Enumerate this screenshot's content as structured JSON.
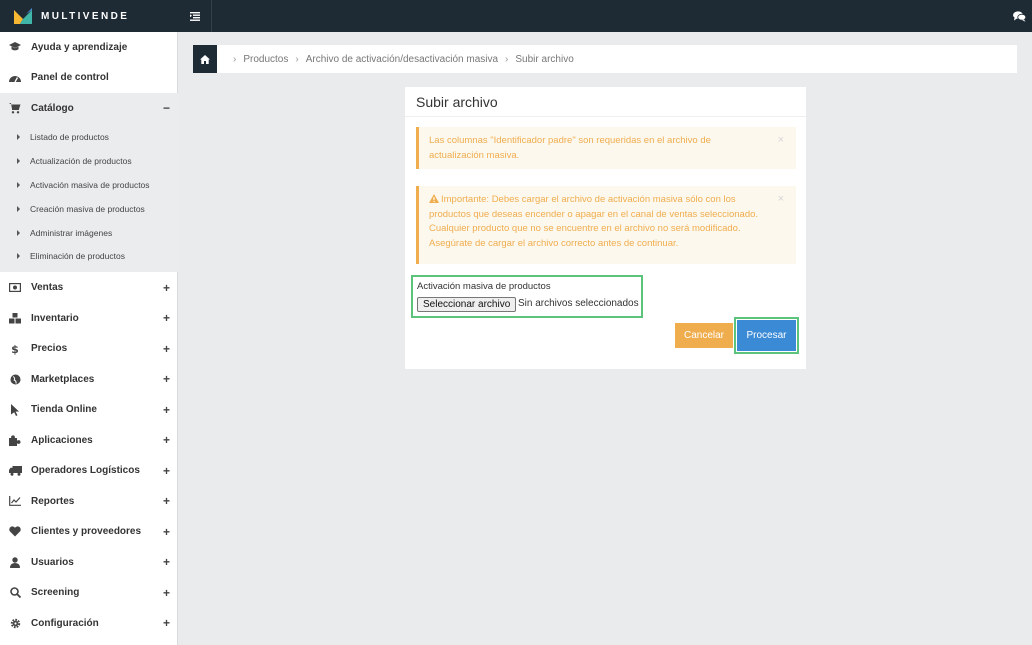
{
  "brand": {
    "name": "MULTIVENDE"
  },
  "sidebar": {
    "items": [
      {
        "label": "Ayuda y aprendizaje",
        "icon": "graduation-cap-icon"
      },
      {
        "label": "Panel de control",
        "icon": "dashboard-icon"
      },
      {
        "label": "Catálogo",
        "icon": "cart-icon",
        "toggle": "−",
        "expanded": true,
        "subitems": [
          "Listado de productos",
          "Actualización de productos",
          "Activación masiva de productos",
          "Creación masiva de productos",
          "Administrar imágenes",
          "Eliminación de productos"
        ]
      },
      {
        "label": "Ventas",
        "icon": "money-icon",
        "toggle": "+"
      },
      {
        "label": "Inventario",
        "icon": "cubes-icon",
        "toggle": "+"
      },
      {
        "label": "Precios",
        "icon": "dollar-icon",
        "toggle": "+"
      },
      {
        "label": "Marketplaces",
        "icon": "globe-icon",
        "toggle": "+"
      },
      {
        "label": "Tienda Online",
        "icon": "pointer-icon",
        "toggle": "+"
      },
      {
        "label": "Aplicaciones",
        "icon": "puzzle-icon",
        "toggle": "+"
      },
      {
        "label": "Operadores Logísticos",
        "icon": "truck-icon",
        "toggle": "+"
      },
      {
        "label": "Reportes",
        "icon": "line-chart-icon",
        "toggle": "+"
      },
      {
        "label": "Clientes y proveedores",
        "icon": "heart-icon",
        "toggle": "+"
      },
      {
        "label": "Usuarios",
        "icon": "user-icon",
        "toggle": "+"
      },
      {
        "label": "Screening",
        "icon": "search-icon",
        "toggle": "+"
      },
      {
        "label": "Configuración",
        "icon": "gear-icon",
        "toggle": "+"
      }
    ]
  },
  "breadcrumb": {
    "items": [
      "Productos",
      "Archivo de activación/desactivación masiva",
      "Subir archivo"
    ],
    "separator": "›"
  },
  "card": {
    "title": "Subir archivo",
    "alert1": "Las columnas \"Identificador padre\" son requeridas en el archivo de actualización masiva.",
    "alert2": "Importante: Debes cargar el archivo de activación masiva sólo con los productos que deseas encender o apagar en el canal de ventas seleccionado. Cualquier producto que no se encuentre en el archivo no será modificado. Asegúrate de cargar el archivo correcto antes de continuar.",
    "close_symbol": "×",
    "field_label": "Activación masiva de productos",
    "file_button": "Seleccionar archivo",
    "file_status": "Sin archivos seleccionados",
    "cancel_label": "Cancelar",
    "process_label": "Procesar"
  },
  "colors": {
    "dark": "#1e2a34",
    "warning": "#f0ad4e",
    "primary": "#3a8ad6",
    "highlight": "#5cc37d"
  }
}
